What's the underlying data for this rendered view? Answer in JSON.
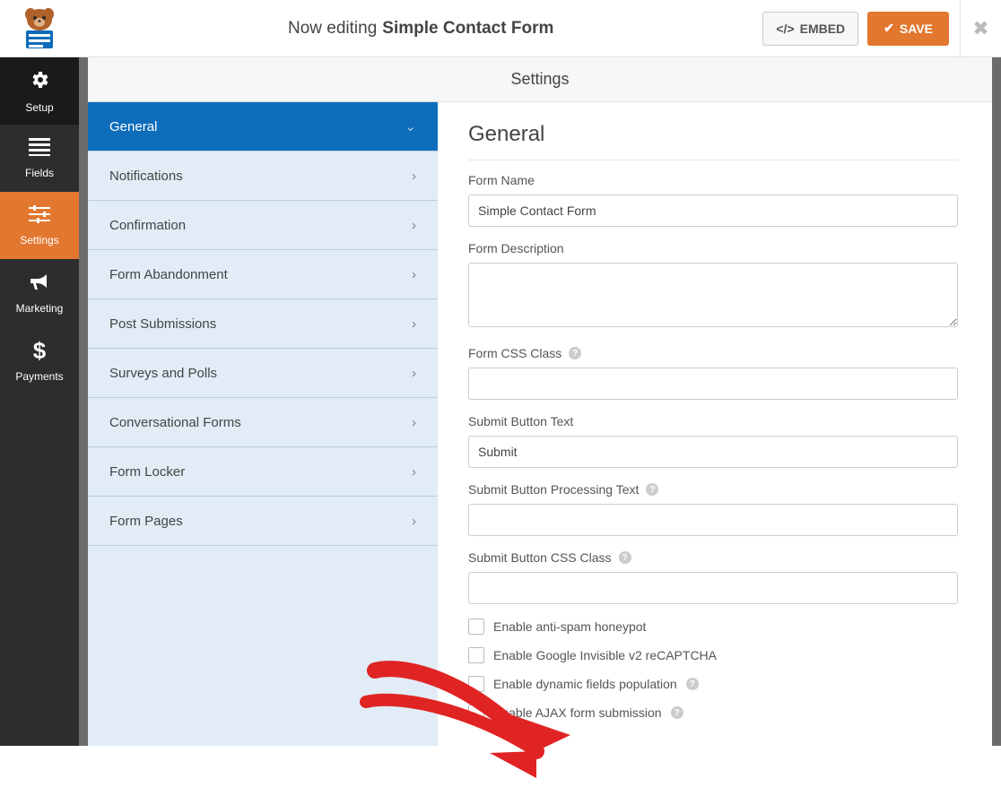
{
  "topbar": {
    "editing_prefix": "Now editing",
    "editing_name": "Simple Contact Form",
    "embed_label": "EMBED",
    "save_label": "SAVE"
  },
  "leftnav": {
    "items": [
      {
        "label": "Setup",
        "icon": "gear"
      },
      {
        "label": "Fields",
        "icon": "list"
      },
      {
        "label": "Settings",
        "icon": "sliders",
        "active": true
      },
      {
        "label": "Marketing",
        "icon": "bullhorn"
      },
      {
        "label": "Payments",
        "icon": "dollar"
      }
    ]
  },
  "panel_title": "Settings",
  "sidebar": {
    "items": [
      {
        "label": "General",
        "active": true,
        "chevron": "down"
      },
      {
        "label": "Notifications"
      },
      {
        "label": "Confirmation"
      },
      {
        "label": "Form Abandonment"
      },
      {
        "label": "Post Submissions"
      },
      {
        "label": "Surveys and Polls"
      },
      {
        "label": "Conversational Forms"
      },
      {
        "label": "Form Locker"
      },
      {
        "label": "Form Pages"
      }
    ]
  },
  "form": {
    "heading": "General",
    "name_label": "Form Name",
    "name_value": "Simple Contact Form",
    "desc_label": "Form Description",
    "desc_value": "",
    "css_label": "Form CSS Class",
    "css_value": "",
    "submit_text_label": "Submit Button Text",
    "submit_text_value": "Submit",
    "submit_proc_label": "Submit Button Processing Text",
    "submit_proc_value": "",
    "submit_css_label": "Submit Button CSS Class",
    "submit_css_value": "",
    "checks": [
      {
        "label": "Enable anti-spam honeypot",
        "help": false
      },
      {
        "label": "Enable Google Invisible v2 reCAPTCHA",
        "help": false
      },
      {
        "label": "Enable dynamic fields population",
        "help": true
      },
      {
        "label": "Enable AJAX form submission",
        "help": true
      }
    ]
  }
}
